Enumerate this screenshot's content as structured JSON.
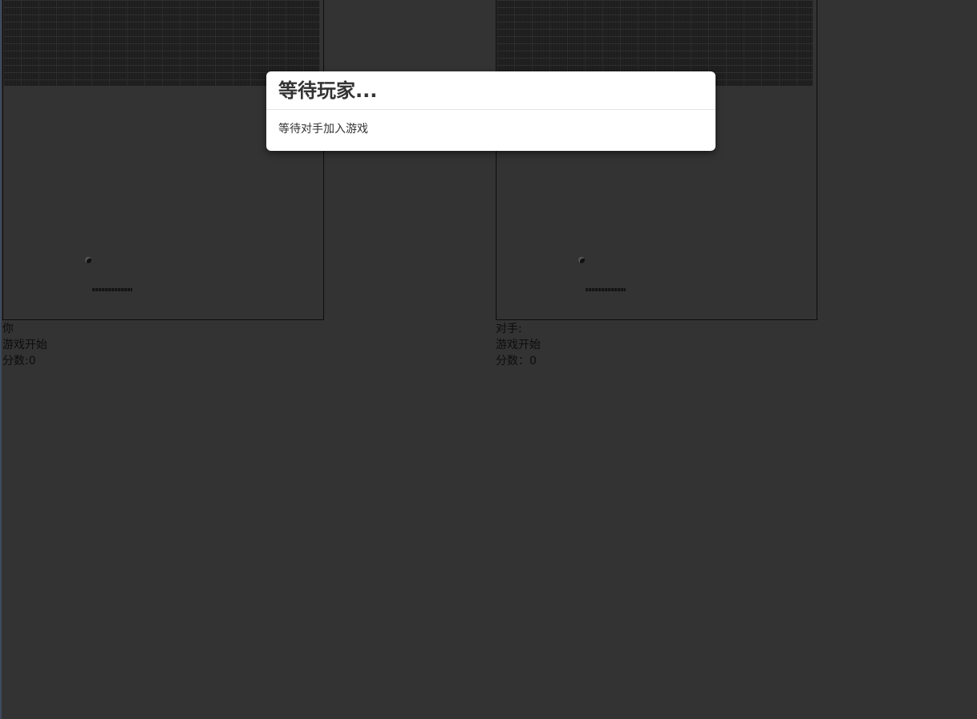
{
  "player": {
    "label": "你",
    "status": "游戏开始",
    "score": "分数:0"
  },
  "opponent": {
    "label": "对手:",
    "status": "游戏开始",
    "score": "分数：0"
  },
  "modal": {
    "title": "等待玩家...",
    "message": "等待对手加入游戏"
  },
  "colors": {
    "background": "#333333",
    "board_border": "#0d0d0d",
    "bricks": "#1b1b1b",
    "modal_background": "#ffffff",
    "text": "#0d0d0d"
  }
}
